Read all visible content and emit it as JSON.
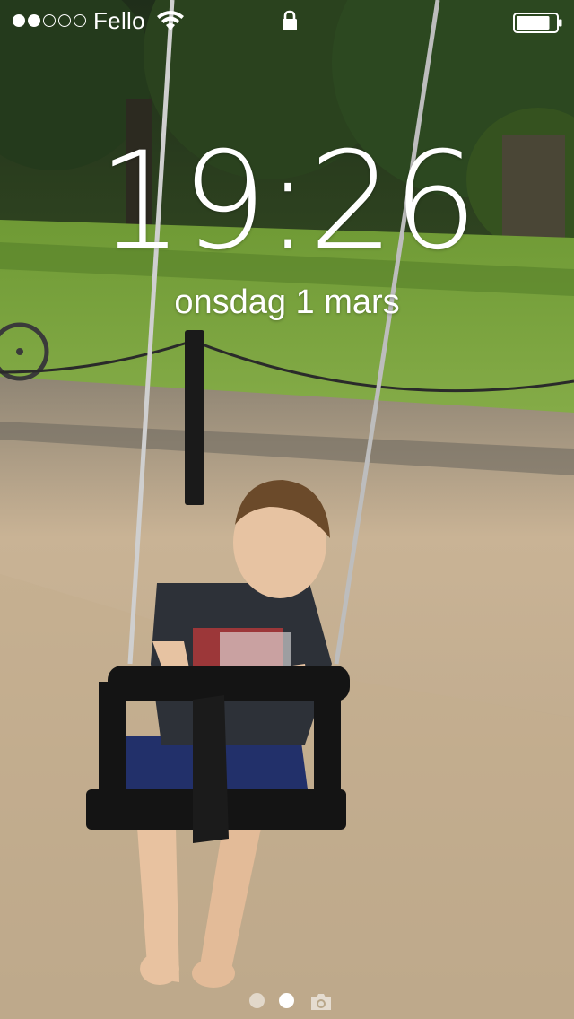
{
  "status_bar": {
    "signal_bars_filled": 2,
    "signal_bars_total": 5,
    "carrier": "Fello",
    "wifi_icon": "wifi-icon",
    "lock_icon": "lock-icon",
    "battery_level": 0.85
  },
  "lock_screen": {
    "time": "19:26",
    "date": "onsdag 1 mars"
  },
  "page_indicator": {
    "pages": 2,
    "current_page": 2,
    "camera_icon": "camera-icon"
  },
  "wallpaper": {
    "description_icon": "photo-wallpaper"
  }
}
